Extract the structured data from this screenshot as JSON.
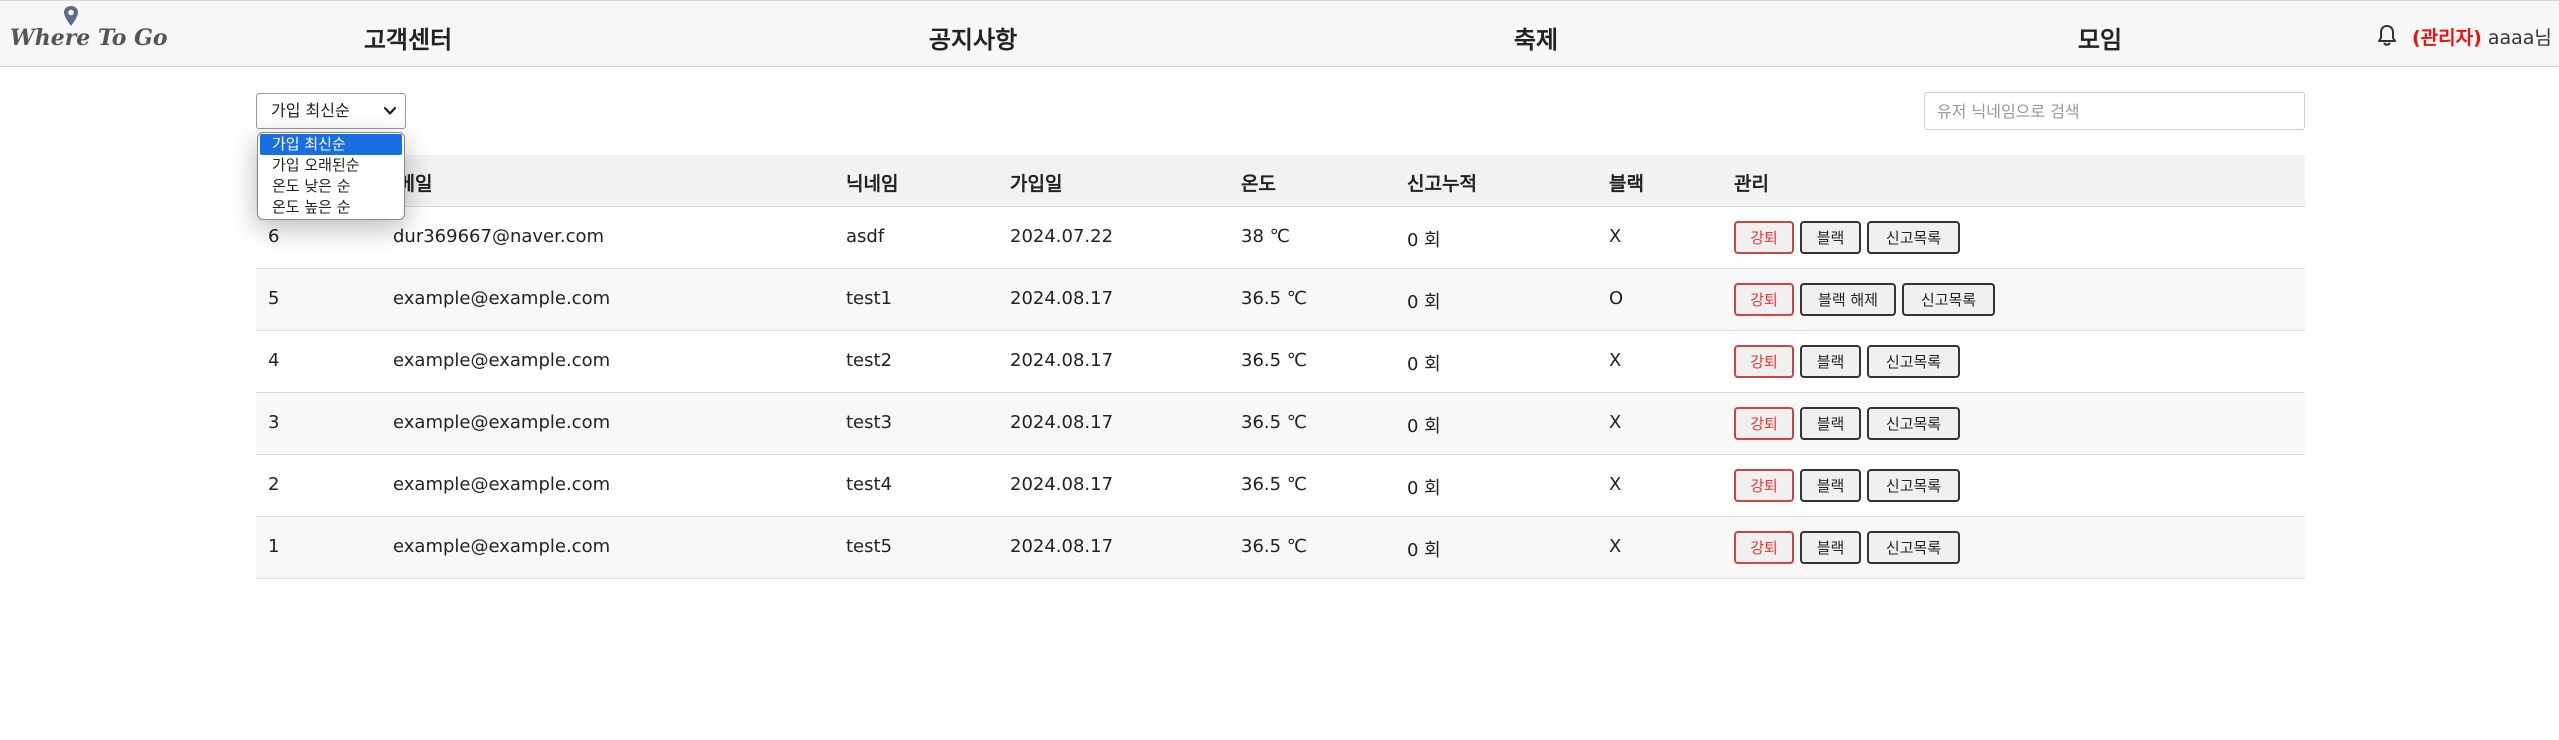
{
  "header": {
    "logo_text": "Where To Go",
    "nav": [
      "고객센터",
      "공지사항",
      "축제",
      "모임"
    ],
    "admin_label": "(관리자)",
    "username": "aaaa님"
  },
  "controls": {
    "sort_selected": "가입 최신순",
    "sort_options": [
      "가입 최신순",
      "가입 오래된순",
      "온도 낮은 순",
      "온도 높은 순"
    ],
    "search_placeholder": "유저 닉네임으로 검색"
  },
  "table": {
    "columns": [
      "이메일",
      "닉네임",
      "가입일",
      "온도",
      "신고누적",
      "블랙",
      "관리"
    ],
    "rows": [
      {
        "id": "6",
        "email": "dur369667@naver.com",
        "nickname": "asdf",
        "joined": "2024.07.22",
        "temp": "38 ℃",
        "reports": "0 회",
        "black": "X",
        "actions": [
          "강퇴",
          "블랙",
          "신고목록"
        ]
      },
      {
        "id": "5",
        "email": "example@example.com",
        "nickname": "test1",
        "joined": "2024.08.17",
        "temp": "36.5 ℃",
        "reports": "0 회",
        "black": "O",
        "actions": [
          "강퇴",
          "블랙 해제",
          "신고목록"
        ]
      },
      {
        "id": "4",
        "email": "example@example.com",
        "nickname": "test2",
        "joined": "2024.08.17",
        "temp": "36.5 ℃",
        "reports": "0 회",
        "black": "X",
        "actions": [
          "강퇴",
          "블랙",
          "신고목록"
        ]
      },
      {
        "id": "3",
        "email": "example@example.com",
        "nickname": "test3",
        "joined": "2024.08.17",
        "temp": "36.5 ℃",
        "reports": "0 회",
        "black": "X",
        "actions": [
          "강퇴",
          "블랙",
          "신고목록"
        ]
      },
      {
        "id": "2",
        "email": "example@example.com",
        "nickname": "test4",
        "joined": "2024.08.17",
        "temp": "36.5 ℃",
        "reports": "0 회",
        "black": "X",
        "actions": [
          "강퇴",
          "블랙",
          "신고목록"
        ]
      },
      {
        "id": "1",
        "email": "example@example.com",
        "nickname": "test5",
        "joined": "2024.08.17",
        "temp": "36.5 ℃",
        "reports": "0 회",
        "black": "X",
        "actions": [
          "강퇴",
          "블랙",
          "신고목록"
        ]
      }
    ]
  },
  "colors": {
    "accent": "#1a6fe0",
    "admin": "#ee1111",
    "kick": "#ee3333"
  }
}
